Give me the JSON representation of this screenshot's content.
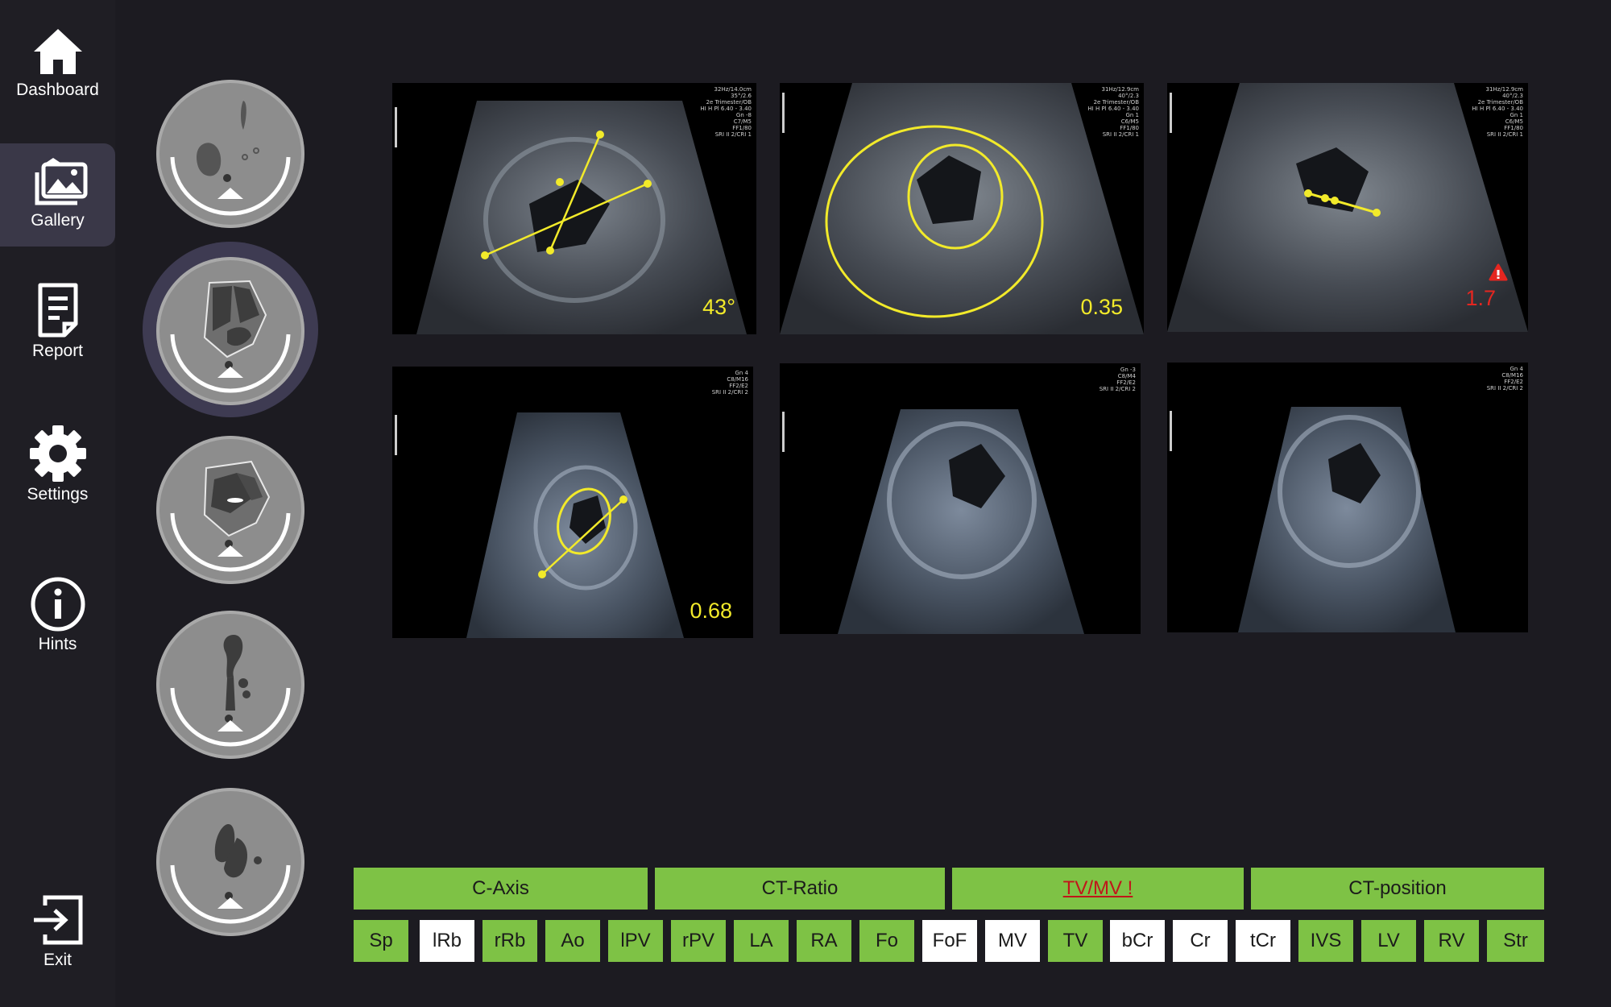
{
  "nav": {
    "items": [
      {
        "label": "Dashboard",
        "icon": "home-icon"
      },
      {
        "label": "Gallery",
        "icon": "gallery-icon"
      },
      {
        "label": "Report",
        "icon": "report-icon"
      },
      {
        "label": "Settings",
        "icon": "gear-icon"
      },
      {
        "label": "Hints",
        "icon": "info-icon"
      },
      {
        "label": "Exit",
        "icon": "exit-icon"
      }
    ],
    "active": "Gallery"
  },
  "views": [
    "abdominal-situs-view",
    "four-chamber-view",
    "five-chamber-view",
    "three-vessel-view",
    "outflow-tract-view"
  ],
  "images": [
    {
      "measurement": "43°",
      "info": "32Hz/14.0cm\n35°/2.6\n2e Trimester/OB\nHI H Pl 6.40 - 3.40\nGn -8\nC7/M5\nFF1/80\nSRI II 2/CRI 1"
    },
    {
      "measurement": "0.35",
      "info": "31Hz/12.9cm\n40°/2.3\n2e Trimester/OB\nHI H Pl 6.40 - 3.40\nGn 1\nC6/M5\nFF1/80\nSRI II 2/CRI 1"
    },
    {
      "measurement": "1.7",
      "alert": true,
      "info": "31Hz/12.9cm\n40°/2.3\n2e Trimester/OB\nHI H Pl 6.40 - 3.40\nGn 1\nC6/M5\nFF1/80\nSRI II 2/CRI 1"
    },
    {
      "measurement": "0.68",
      "info": "Gn 4\nC8/M16\nFF2/E2\nSRI II 2/CRI 2"
    },
    {
      "measurement": "",
      "info": "Gn -3\nC8/M4\nFF2/E2\nSRI II 2/CRI 2"
    },
    {
      "measurement": "",
      "info": "Gn 4\nC8/M16\nFF2/E2\nSRI II 2/CRI 2"
    }
  ],
  "categories": [
    {
      "label": "C-Axis",
      "warning": false
    },
    {
      "label": "CT-Ratio",
      "warning": false
    },
    {
      "label": "TV/MV !",
      "warning": true
    },
    {
      "label": "CT-position",
      "warning": false
    }
  ],
  "structures": [
    {
      "label": "Sp",
      "state": "ok"
    },
    {
      "label": "lRb",
      "state": "missing"
    },
    {
      "label": "rRb",
      "state": "ok"
    },
    {
      "label": "Ao",
      "state": "ok"
    },
    {
      "label": "lPV",
      "state": "ok"
    },
    {
      "label": "rPV",
      "state": "ok"
    },
    {
      "label": "LA",
      "state": "ok"
    },
    {
      "label": "RA",
      "state": "ok"
    },
    {
      "label": "Fo",
      "state": "ok"
    },
    {
      "label": "FoF",
      "state": "missing"
    },
    {
      "label": "MV",
      "state": "missing"
    },
    {
      "label": "TV",
      "state": "ok"
    },
    {
      "label": "bCr",
      "state": "missing"
    },
    {
      "label": "Cr",
      "state": "missing"
    },
    {
      "label": "tCr",
      "state": "missing"
    },
    {
      "label": "IVS",
      "state": "ok"
    },
    {
      "label": "LV",
      "state": "ok"
    },
    {
      "label": "RV",
      "state": "ok"
    },
    {
      "label": "Str",
      "state": "ok"
    }
  ],
  "colors": {
    "ok": "#7ec245",
    "missing": "#ffffff",
    "measure": "#f2ea2a",
    "alert": "#e52620"
  }
}
